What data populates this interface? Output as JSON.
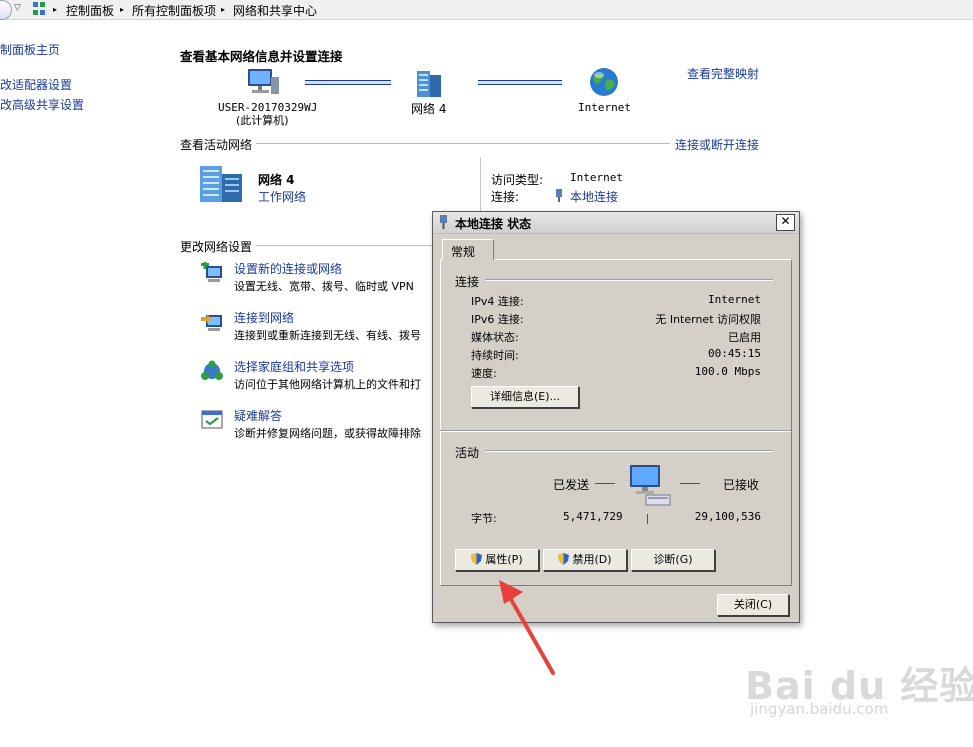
{
  "breadcrumb": {
    "items": [
      "控制面板",
      "所有控制面板项",
      "网络和共享中心"
    ]
  },
  "sidebar": {
    "items": [
      {
        "label": "制面板主页"
      },
      {
        "label": "改适配器设置"
      },
      {
        "label": "改高级共享设置"
      }
    ]
  },
  "header": {
    "title": "查看基本网络信息并设置连接",
    "full_map_link": "查看完整映射"
  },
  "topology": {
    "computer_name": "USER-20170329WJ",
    "computer_sub": "(此计算机)",
    "network": "网络  4",
    "internet": "Internet"
  },
  "active": {
    "title": "查看活动网络",
    "connect_link": "连接或断开连接",
    "network_name": "网络  4",
    "network_type": "工作网络",
    "access_type_label": "访问类型:",
    "access_type_value": "Internet",
    "connection_label": "连接:",
    "connection_value": "本地连接"
  },
  "change": {
    "title": "更改网络设置",
    "items": [
      {
        "title": "设置新的连接或网络",
        "desc": "设置无线、宽带、拨号、临时或 VPN"
      },
      {
        "title": "连接到网络",
        "desc": "连接到或重新连接到无线、有线、拨号"
      },
      {
        "title": "选择家庭组和共享选项",
        "desc": "访问位于其他网络计算机上的文件和打"
      },
      {
        "title": "疑难解答",
        "desc": "诊断并修复网络问题，或获得故障排除"
      }
    ]
  },
  "dialog": {
    "title": "本地连接  状态",
    "tab": "常规",
    "connection_section": "连接",
    "rows": [
      {
        "label": "IPv4 连接:",
        "value": "Internet"
      },
      {
        "label": "IPv6 连接:",
        "value": "无 Internet 访问权限"
      },
      {
        "label": "媒体状态:",
        "value": "已启用"
      },
      {
        "label": "持续时间:",
        "value": "00:45:15"
      },
      {
        "label": "速度:",
        "value": "100.0 Mbps"
      }
    ],
    "details_button": "详细信息(E)...",
    "activity_section": "活动",
    "sent_label": "已发送",
    "received_label": "已接收",
    "bytes_label": "字节:",
    "bytes_sent": "5,471,729",
    "bytes_received": "29,100,536",
    "properties_button": "属性(P)",
    "disable_button": "禁用(D)",
    "diagnose_button": "诊断(G)",
    "close_button": "关闭(C)"
  },
  "watermark": {
    "brand": "Bai du 经验",
    "url": "jingyan.baidu.com"
  },
  "colors": {
    "link": "#1a3a9a",
    "dialog_bg": "#d4d0c8",
    "arrow": "#e8413b"
  }
}
